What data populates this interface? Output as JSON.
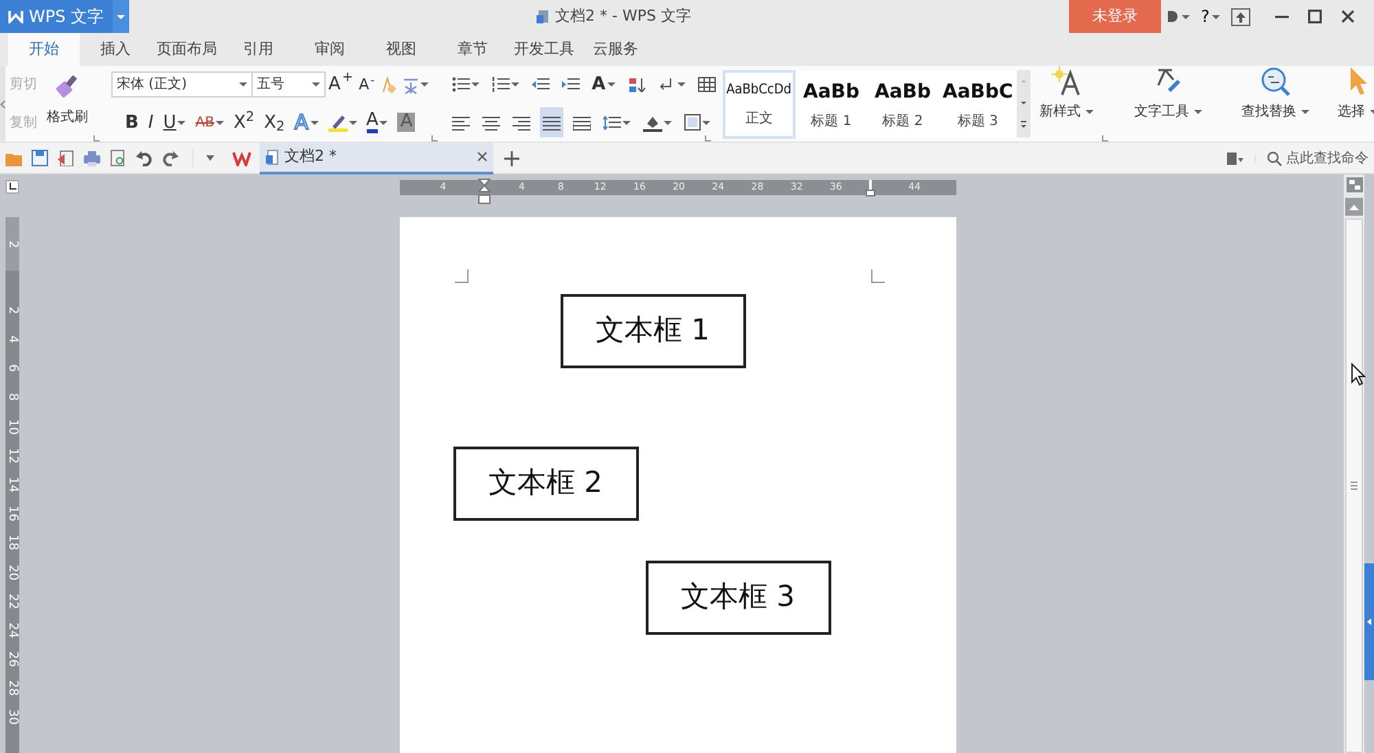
{
  "title_bar": {
    "app_button": "WPS 文字",
    "title": "文档2 * - WPS 文字",
    "login_button": "未登录",
    "help_button": "?"
  },
  "menu_tabs": [
    {
      "label": "开始",
      "selected": true
    },
    {
      "label": "插入",
      "selected": false
    },
    {
      "label": "页面布局",
      "selected": false
    },
    {
      "label": "引用",
      "selected": false
    },
    {
      "label": "审阅",
      "selected": false
    },
    {
      "label": "视图",
      "selected": false
    },
    {
      "label": "章节",
      "selected": false
    },
    {
      "label": "开发工具",
      "selected": false
    },
    {
      "label": "云服务",
      "selected": false
    }
  ],
  "ribbon": {
    "clipboard": [
      {
        "label": "剪切",
        "disabled": true
      },
      {
        "label": "复制",
        "disabled": true
      }
    ],
    "format_painter": "格式刷",
    "font_name": "宋体 (正文)",
    "font_size": "五号",
    "size_buttons": [
      "A$^{+}$",
      "A$^{-}$"
    ],
    "font_buttons": [
      {
        "kind": "bold",
        "glyph": "B",
        "caret": false
      },
      {
        "kind": "italic",
        "glyph": "I",
        "caret": false
      },
      {
        "kind": "underline",
        "glyph": "U",
        "caret": true
      },
      {
        "kind": "strike",
        "glyph": "AB",
        "caret": true
      },
      {
        "kind": "sup",
        "glyph": "X$^{2}$",
        "caret": false
      },
      {
        "kind": "sub",
        "glyph": "X$_{2}$",
        "caret": false
      },
      {
        "kind": "outline",
        "glyph": "A",
        "caret": true
      },
      {
        "kind": "highlight",
        "caret": true
      },
      {
        "kind": "color",
        "glyph": "A",
        "caret": true
      },
      {
        "kind": "shade",
        "glyph": "A",
        "caret": false
      }
    ],
    "case_button": "A",
    "styles": [
      {
        "kind": "body",
        "preview": "AaBbCcDd",
        "label": "正文",
        "selected": true
      },
      {
        "kind": "heading",
        "preview": "AaBb",
        "label": "标题 1",
        "selected": false
      },
      {
        "kind": "heading",
        "preview": "AaBb",
        "label": "标题 2",
        "selected": false
      },
      {
        "kind": "heading",
        "preview": "AaBbC",
        "label": "标题 3",
        "selected": false
      }
    ],
    "big_buttons": [
      {
        "kind": "new-style",
        "label": "新样式"
      },
      {
        "kind": "text-tools",
        "label": "文字工具"
      },
      {
        "kind": "find",
        "label": "查找替换"
      },
      {
        "kind": "select",
        "label": "选择"
      }
    ]
  },
  "tab_bar": {
    "documents": [
      {
        "title": "文档2 *",
        "selected": true
      }
    ],
    "command_search": {
      "placeholder": "点此查找命令"
    }
  },
  "rulers": {
    "horizontal": [
      "4",
      "4",
      "8",
      "12",
      "16",
      "20",
      "24",
      "28",
      "32",
      "36",
      "44"
    ],
    "vertical": [
      "2",
      "2",
      "4",
      "6",
      "8",
      "10",
      "12",
      "14",
      "16",
      "18",
      "20",
      "22",
      "24",
      "26",
      "28",
      "30"
    ]
  },
  "document": {
    "text_boxes": [
      {
        "text": "文本框 1"
      },
      {
        "text": "文本框 2"
      },
      {
        "text": "文本框 3"
      }
    ]
  }
}
